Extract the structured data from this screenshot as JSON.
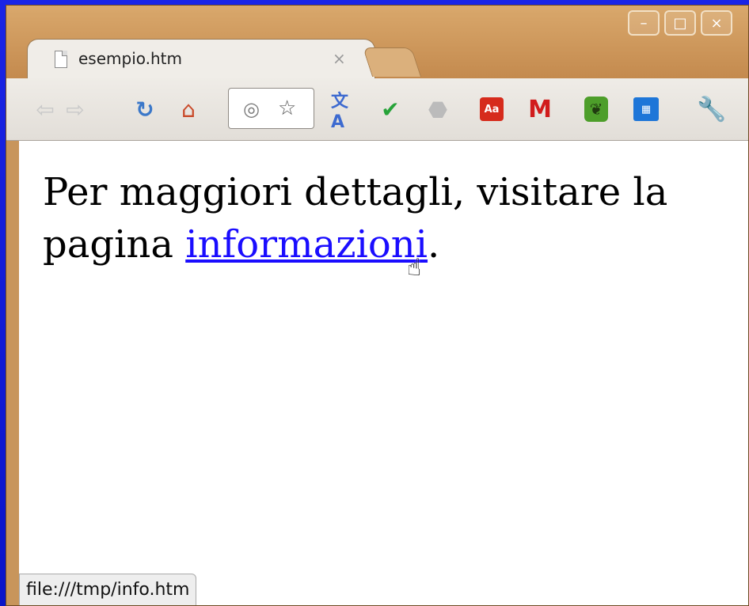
{
  "browser": {
    "tab": {
      "title": "esempio.htm",
      "close_glyph": "×"
    },
    "window_controls": {
      "minimize": "–",
      "maximize": "□",
      "close": "×"
    },
    "toolbar_icons": {
      "back": "back-arrow-icon",
      "forward": "forward-arrow-icon",
      "reload": "reload-icon",
      "home": "home-icon",
      "page": "globe-icon",
      "bookmark": "star-icon",
      "translate": "translate-icon",
      "check": "checkmark-icon",
      "stop": "stop-icon",
      "dictionary": "dictionary-icon",
      "gmail": "gmail-icon",
      "evernote": "evernote-icon",
      "calendar": "calendar-icon",
      "wrench": "wrench-icon"
    },
    "icon_glyphs": {
      "dictionary": "Aa",
      "gmail": "M"
    }
  },
  "page": {
    "text_before": "Per maggiori dettagli, visitare la pagina ",
    "link_text": "informazioni",
    "text_after": ".",
    "link_color": "#1a0dff"
  },
  "status": {
    "url": "file:///tmp/info.htm"
  }
}
